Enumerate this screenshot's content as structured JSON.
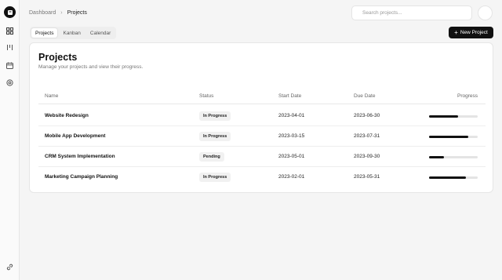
{
  "breadcrumb": {
    "root": "Dashboard",
    "current": "Projects"
  },
  "search": {
    "placeholder": "Search projects..."
  },
  "tabs": [
    {
      "label": "Projects",
      "active": true
    },
    {
      "label": "Kanban",
      "active": false
    },
    {
      "label": "Calendar",
      "active": false
    }
  ],
  "new_project_label": "New Project",
  "card": {
    "title": "Projects",
    "subtitle": "Manage your projects and view their progress."
  },
  "table": {
    "headers": {
      "name": "Name",
      "status": "Status",
      "start": "Start Date",
      "due": "Due Date",
      "progress": "Progress"
    },
    "rows": [
      {
        "name": "Website Redesign",
        "status": "In Progress",
        "start": "2023-04-01",
        "due": "2023-06-30",
        "progress": 0.6
      },
      {
        "name": "Mobile App Development",
        "status": "In Progress",
        "start": "2023-03-15",
        "due": "2023-07-31",
        "progress": 0.8
      },
      {
        "name": "CRM System Implementation",
        "status": "Pending",
        "start": "2023-05-01",
        "due": "2023-09-30",
        "progress": 0.3
      },
      {
        "name": "Marketing Campaign Planning",
        "status": "In Progress",
        "start": "2023-02-01",
        "due": "2023-05-31",
        "progress": 0.75
      }
    ]
  },
  "icons": {
    "logo": "box-logo-icon",
    "nav": [
      "grid-icon",
      "kanban-icon",
      "calendar-icon",
      "settings-icon"
    ],
    "bottom": "link-icon"
  },
  "colors": {
    "accent": "#111111",
    "progress_track": "#e4e4e4",
    "badge_bg": "#f1f1f1"
  }
}
